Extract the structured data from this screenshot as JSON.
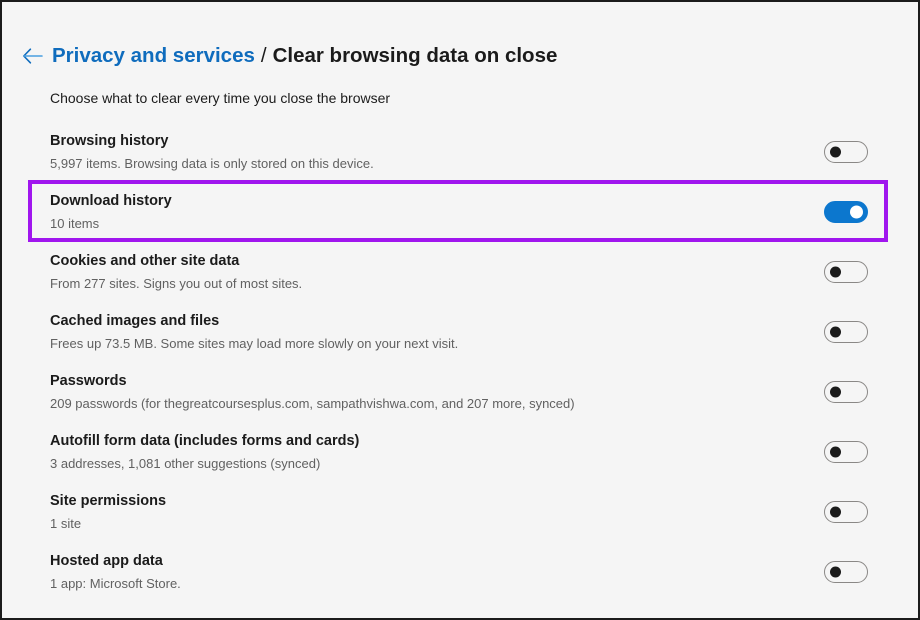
{
  "header": {
    "back_icon": "arrow-left-icon",
    "parent_label": "Privacy and services",
    "separator": "/",
    "current_label": "Clear browsing data on close"
  },
  "subtitle": "Choose what to clear every time you close the browser",
  "colors": {
    "link": "#0f6cbd",
    "toggle_on": "#0c77ce",
    "toggle_off_border": "#8a8886",
    "highlight": "#a016ee",
    "background": "#f5f5f5",
    "text": "#1b1b1b",
    "muted_text": "#616161"
  },
  "highlight": {
    "target_row": "download-history",
    "color": "#a016ee"
  },
  "settings": [
    {
      "key": "browsing-history",
      "title": "Browsing history",
      "description": "5,997 items. Browsing data is only stored on this device.",
      "toggle_state": "off",
      "highlighted": false
    },
    {
      "key": "download-history",
      "title": "Download history",
      "description": "10 items",
      "toggle_state": "on",
      "highlighted": true
    },
    {
      "key": "cookies-and-other-site-data",
      "title": "Cookies and other site data",
      "description": "From 277 sites. Signs you out of most sites.",
      "toggle_state": "off",
      "highlighted": false
    },
    {
      "key": "cached-images-and-files",
      "title": "Cached images and files",
      "description": "Frees up 73.5 MB. Some sites may load more slowly on your next visit.",
      "toggle_state": "off",
      "highlighted": false
    },
    {
      "key": "passwords",
      "title": "Passwords",
      "description": "209 passwords (for thegreatcoursesplus.com, sampathvishwa.com, and 207 more, synced)",
      "toggle_state": "off",
      "highlighted": false
    },
    {
      "key": "autofill-form-data",
      "title": "Autofill form data (includes forms and cards)",
      "description": "3 addresses, 1,081 other suggestions (synced)",
      "toggle_state": "off",
      "highlighted": false
    },
    {
      "key": "site-permissions",
      "title": "Site permissions",
      "description": "1 site",
      "toggle_state": "off",
      "highlighted": false
    },
    {
      "key": "hosted-app-data",
      "title": "Hosted app data",
      "description": "1 app: Microsoft Store.",
      "toggle_state": "off",
      "highlighted": false
    }
  ]
}
